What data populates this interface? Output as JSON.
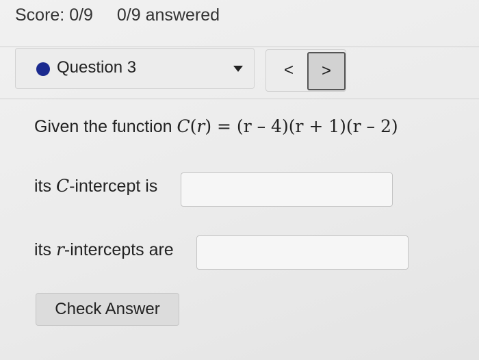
{
  "header": {
    "score": "Score: 0/9",
    "answered": "0/9 answered"
  },
  "question_nav": {
    "selected": "Question 3",
    "prev": "<",
    "next": ">",
    "status_color": "#1b2a8f"
  },
  "question": {
    "intro": "Given the function ",
    "func_name": "C",
    "var": "r",
    "equation_rest": " = (r – 4)(r + 1)(r – 2)",
    "c_intercept_prefix": "its ",
    "c_intercept_var": "C",
    "c_intercept_suffix": "-intercept is",
    "r_intercept_prefix": "its ",
    "r_intercept_var": "r",
    "r_intercept_suffix": "-intercepts are",
    "c_intercept_value": "",
    "r_intercepts_value": ""
  },
  "actions": {
    "check_answer": "Check Answer"
  }
}
